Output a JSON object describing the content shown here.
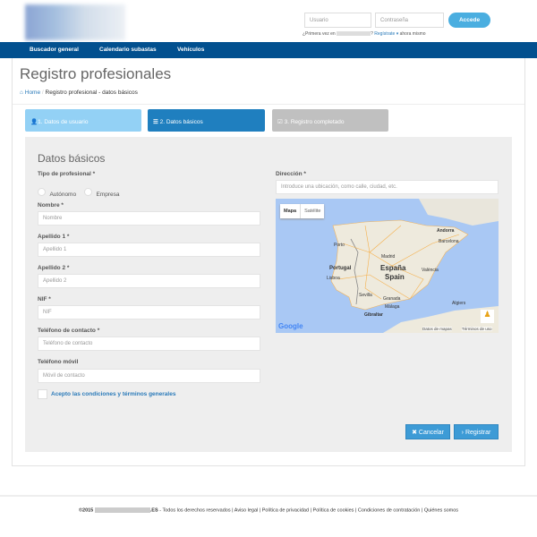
{
  "header": {
    "login_user_placeholder": "Usuario",
    "login_password_placeholder": "Contraseña",
    "login_button": "Accede",
    "first_time_prefix": "¿Primera vez en",
    "first_time_suffix": "?",
    "register_link": "Regístrate",
    "register_tail": "ahora mismo"
  },
  "nav": {
    "items": [
      "Buscador general",
      "Calendario subastas",
      "Vehículos"
    ]
  },
  "page": {
    "title": "Registro profesionales",
    "breadcrumb": {
      "home": "Home",
      "sep": "/",
      "current": "Registro profesional - datos básicos"
    }
  },
  "steps": [
    {
      "label": "1. Datos de usuario",
      "icon": "user-icon",
      "color": "#93d1f5"
    },
    {
      "label": "2. Datos básicos",
      "icon": "list-icon",
      "color": "#1f7fbf"
    },
    {
      "label": "3. Registro completado",
      "icon": "checkbox-icon",
      "color": "#c0c0c0"
    }
  ],
  "form": {
    "heading": "Datos básicos",
    "tipo_label": "Tipo de profesional *",
    "tipo_options": [
      "Autónomo",
      "Empresa"
    ],
    "nombre_label": "Nombre *",
    "nombre_placeholder": "Nombre",
    "apellido1_label": "Apellido 1 *",
    "apellido1_placeholder": "Apellido 1",
    "apellido2_label": "Apellido 2 *",
    "apellido2_placeholder": "Apellido 2",
    "nif_label": "NIF *",
    "nif_placeholder": "NIF",
    "telefono_label": "Teléfono de contacto *",
    "telefono_placeholder": "Teléfono de contacto",
    "movil_label": "Teléfono móvil",
    "movil_placeholder": "Móvil de contacto",
    "terms_label": "Acepto las condiciones y términos generales",
    "direccion_label": "Dirección *",
    "direccion_placeholder": "Introduce una ubicación, como calle, ciudad, etc.",
    "cancel": "Cancelar",
    "submit": "Registrar"
  },
  "map": {
    "type_map": "Mapa",
    "type_satellite": "Satélite",
    "labels": {
      "porto": "Porto",
      "portugal": "Portugal",
      "lisboa": "Lisboa",
      "madrid": "Madrid",
      "espana": "España",
      "spain": "Spain",
      "valencia": "València",
      "barcelona": "Barcelona",
      "andorra": "Andorra",
      "sevilla": "Sevilla",
      "granada": "Granada",
      "malaga": "Málaga",
      "gibraltar": "Gibraltar",
      "alger": "Algiers"
    },
    "attribution": "Datos de mapas",
    "terms": "Términos de uso",
    "google": "Google"
  },
  "footer": {
    "copyright": "©2015",
    "domain_suffix": ".ES",
    "rights": "- Todos los derechos reservados |",
    "links": [
      "Aviso legal",
      "Política de privacidad",
      "Política de cookies",
      "Condiciones de contratación",
      "Quiénes somos"
    ]
  }
}
